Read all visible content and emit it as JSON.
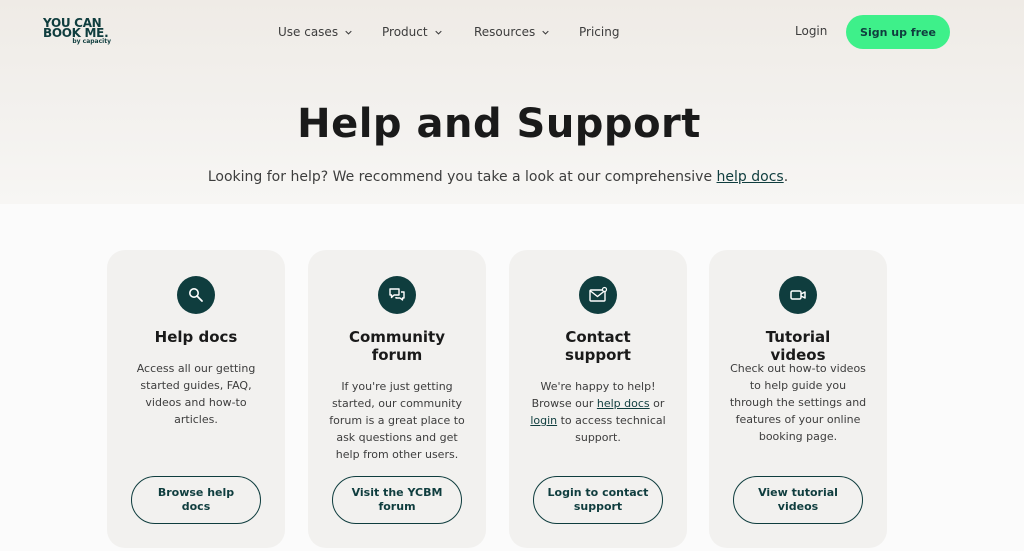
{
  "header": {
    "logo": {
      "line1": "YOU CAN",
      "line2": "BOOK ME.",
      "by": "by capacity"
    },
    "nav": [
      {
        "label": "Use cases",
        "has_dropdown": true
      },
      {
        "label": "Product",
        "has_dropdown": true
      },
      {
        "label": "Resources",
        "has_dropdown": true
      },
      {
        "label": "Pricing",
        "has_dropdown": false
      }
    ],
    "login_label": "Login",
    "signup_label": "Sign up free"
  },
  "hero": {
    "title": "Help and Support",
    "subtitle_before": "Looking for help? We recommend you take a look at our comprehensive ",
    "subtitle_link": "help docs",
    "subtitle_after": "."
  },
  "cards": [
    {
      "icon": "magnifier-icon",
      "title": "Help docs",
      "desc": "Access all our getting started guides, FAQ, videos and how-to articles.",
      "button": "Browse help docs"
    },
    {
      "icon": "chat-bubbles-icon",
      "title": "Community forum",
      "desc": "If you're just getting started, our community forum is a great place to ask questions and get help from other users.",
      "button": "Visit the YCBM forum"
    },
    {
      "icon": "mail-icon",
      "title": "Contact support",
      "desc_parts": [
        "We're happy to help! Browse our ",
        "help docs",
        " or ",
        "login",
        " to access technical support."
      ],
      "button": "Login to contact support"
    },
    {
      "icon": "video-camera-icon",
      "title": "Tutorial videos",
      "desc": "Check out how-to videos to help guide you through the settings and features of your online booking page.",
      "button": "View tutorial videos"
    }
  ],
  "colors": {
    "brand_dark": "#0f3d3e",
    "accent_green": "#3ef08a",
    "card_bg": "#f2f1ef"
  }
}
